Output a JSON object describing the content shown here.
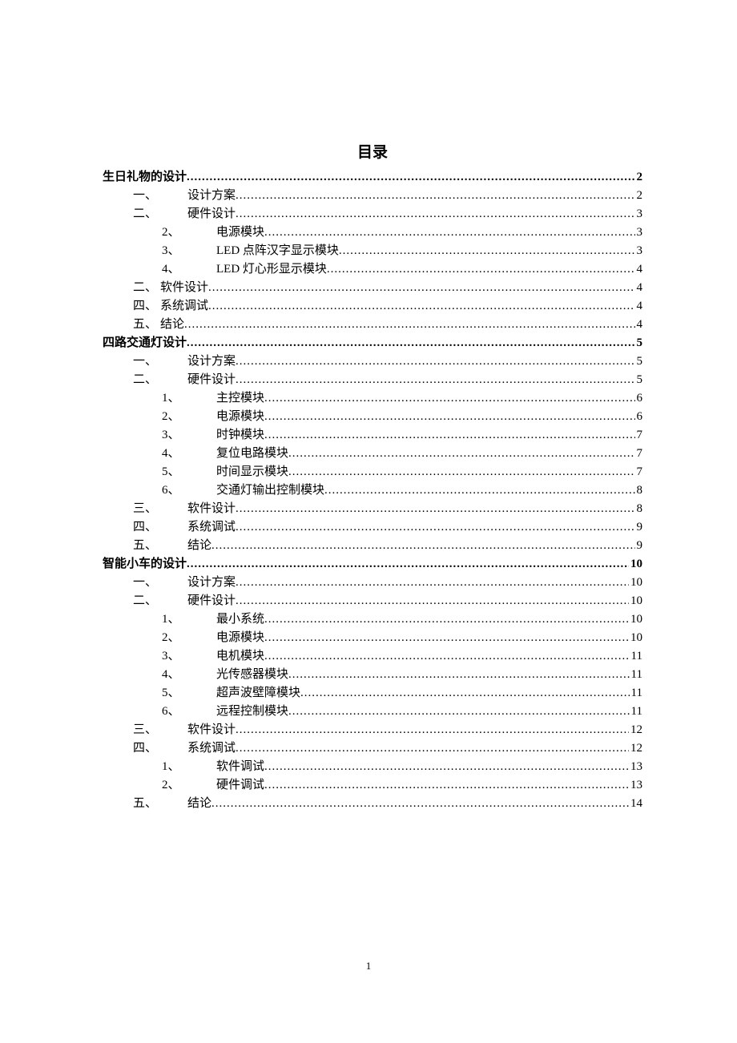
{
  "title": "目录",
  "footer_page": "1",
  "toc": [
    {
      "indent": "indent-0",
      "bold": true,
      "num": "",
      "text": "生日礼物的设计",
      "page": "2"
    },
    {
      "indent": "indent-1",
      "bold": false,
      "num": "一、",
      "text": "设计方案",
      "page": "2"
    },
    {
      "indent": "indent-1",
      "bold": false,
      "num": "二、",
      "text": "硬件设计",
      "page": "3"
    },
    {
      "indent": "indent-2",
      "bold": false,
      "num": "2、",
      "text": "电源模块",
      "page": "3"
    },
    {
      "indent": "indent-2",
      "bold": false,
      "num": "3、",
      "text": "LED 点阵汉字显示模块",
      "page": "3"
    },
    {
      "indent": "indent-2",
      "bold": false,
      "num": "4、",
      "text": "LED 灯心形显示模块",
      "page": "4"
    },
    {
      "indent": "indent-1b",
      "bold": false,
      "num": "二、",
      "text": "软件设计",
      "page": "4",
      "tight": true
    },
    {
      "indent": "indent-1b",
      "bold": false,
      "num": "四、",
      "text": "系统调试",
      "page": "4",
      "tight": true
    },
    {
      "indent": "indent-1b",
      "bold": false,
      "num": "五、",
      "text": "结论",
      "page": "4",
      "tight": true
    },
    {
      "indent": "indent-0",
      "bold": true,
      "num": "",
      "text": "四路交通灯设计",
      "page": "5"
    },
    {
      "indent": "indent-1",
      "bold": false,
      "num": "一、",
      "text": "设计方案",
      "page": "5"
    },
    {
      "indent": "indent-1",
      "bold": false,
      "num": "二、",
      "text": "硬件设计",
      "page": "5"
    },
    {
      "indent": "indent-2",
      "bold": false,
      "num": "1、",
      "text": "主控模块",
      "page": "6"
    },
    {
      "indent": "indent-2",
      "bold": false,
      "num": "2、",
      "text": "电源模块",
      "page": "6"
    },
    {
      "indent": "indent-2",
      "bold": false,
      "num": "3、",
      "text": "时钟模块",
      "page": "7"
    },
    {
      "indent": "indent-2",
      "bold": false,
      "num": "4、",
      "text": "复位电路模块",
      "page": "7"
    },
    {
      "indent": "indent-2",
      "bold": false,
      "num": "5、",
      "text": "时间显示模块",
      "page": "7"
    },
    {
      "indent": "indent-2",
      "bold": false,
      "num": "6、",
      "text": "交通灯输出控制模块",
      "page": "8"
    },
    {
      "indent": "indent-1",
      "bold": false,
      "num": "三、",
      "text": "软件设计",
      "page": "8"
    },
    {
      "indent": "indent-1",
      "bold": false,
      "num": "四、",
      "text": "系统调试",
      "page": "9"
    },
    {
      "indent": "indent-1",
      "bold": false,
      "num": "五、",
      "text": "结论",
      "page": "9"
    },
    {
      "indent": "indent-0",
      "bold": true,
      "num": "",
      "text": "智能小车的设计",
      "page": "10"
    },
    {
      "indent": "indent-1",
      "bold": false,
      "num": "一、",
      "text": "设计方案",
      "page": "10"
    },
    {
      "indent": "indent-1",
      "bold": false,
      "num": "二、",
      "text": "硬件设计",
      "page": "10"
    },
    {
      "indent": "indent-2",
      "bold": false,
      "num": "1、",
      "text": "最小系统",
      "page": "10"
    },
    {
      "indent": "indent-2",
      "bold": false,
      "num": "2、",
      "text": "电源模块",
      "page": "10"
    },
    {
      "indent": "indent-2",
      "bold": false,
      "num": "3、",
      "text": "电机模块",
      "page": "11"
    },
    {
      "indent": "indent-2",
      "bold": false,
      "num": "4、",
      "text": "光传感器模块",
      "page": "11"
    },
    {
      "indent": "indent-2",
      "bold": false,
      "num": "5、",
      "text": "超声波壁障模块",
      "page": "11"
    },
    {
      "indent": "indent-2",
      "bold": false,
      "num": "6、",
      "text": "远程控制模块",
      "page": "11"
    },
    {
      "indent": "indent-1",
      "bold": false,
      "num": "三、",
      "text": "软件设计",
      "page": "12"
    },
    {
      "indent": "indent-1",
      "bold": false,
      "num": "四、",
      "text": "系统调试",
      "page": "12"
    },
    {
      "indent": "indent-2",
      "bold": false,
      "num": "1、",
      "text": "软件调试",
      "page": "13"
    },
    {
      "indent": "indent-2",
      "bold": false,
      "num": "2、",
      "text": "硬件调试",
      "page": "13"
    },
    {
      "indent": "indent-1",
      "bold": false,
      "num": "五、",
      "text": "结论",
      "page": "14"
    }
  ]
}
